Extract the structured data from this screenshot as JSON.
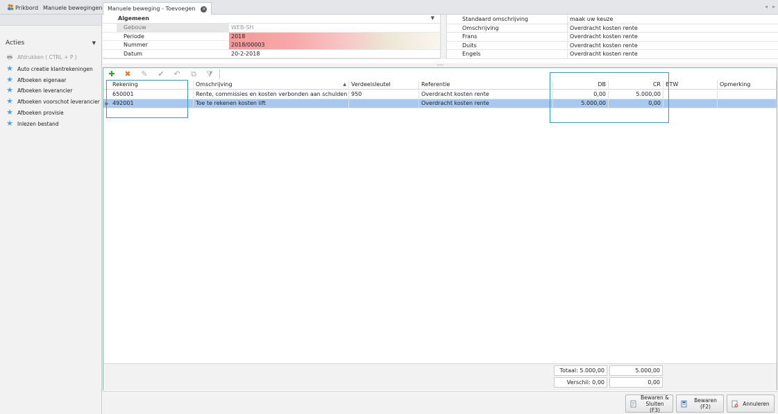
{
  "tabs": [
    {
      "label": "Prikbord",
      "icon": "people-icon"
    },
    {
      "label": "Manuele bewegingen"
    },
    {
      "label": "Manuele beweging - Toevoegen",
      "active": true
    }
  ],
  "sidebar": {
    "title": "Acties",
    "items": [
      {
        "label": "Afdrukken ( CTRL + P )",
        "disabled": true,
        "icon": "printer-icon"
      },
      {
        "label": "Auto creatie klantrekeningen",
        "icon": "star-icon"
      },
      {
        "label": "Afboeken eigenaar",
        "icon": "star-icon"
      },
      {
        "label": "Afboeken leverancier",
        "icon": "star-icon"
      },
      {
        "label": "Afboeken voorschot leverancier",
        "icon": "star-icon"
      },
      {
        "label": "Afboeken provisie",
        "icon": "star-icon"
      },
      {
        "label": "Inlezen bestand",
        "icon": "star-icon"
      }
    ]
  },
  "form_left": {
    "group_title": "Algemeen",
    "rows": [
      {
        "label": "Gebouw",
        "value": "WEB-SH"
      },
      {
        "label": "Periode",
        "value": "2018"
      },
      {
        "label": "Nummer",
        "value": "2018/00003"
      },
      {
        "label": "Datum",
        "value": "20-2-2018"
      }
    ]
  },
  "form_right": {
    "rows": [
      {
        "label": "Standaard omschrijving",
        "value": "maak uw keuze"
      },
      {
        "label": "Omschrijving",
        "value": "Overdracht kosten rente"
      },
      {
        "label": "Frans",
        "value": "Overdracht kosten rente"
      },
      {
        "label": "Duits",
        "value": "Overdracht kosten rente"
      },
      {
        "label": "Engels",
        "value": "Overdracht kosten rente"
      }
    ]
  },
  "grid": {
    "columns": [
      "Rekening",
      "Omschrijving",
      "Verdeelsleutel",
      "Referentie",
      "DB",
      "CR",
      "BTW",
      "Opmerking"
    ],
    "rows": [
      {
        "rekening": "650001",
        "omschrijving": "Rente, commissies en kosten verbonden aan schulden",
        "verdeelsleutel": "950",
        "referentie": "Overdracht kosten rente",
        "db": "0,00",
        "cr": "5.000,00",
        "btw": "",
        "opmerking": ""
      },
      {
        "rekening": "492001",
        "omschrijving": "Toe te rekenen kosten lift",
        "verdeelsleutel": "",
        "referentie": "Overdracht kosten rente",
        "db": "5.000,00",
        "cr": "0,00",
        "btw": "",
        "opmerking": "",
        "selected": true
      }
    ]
  },
  "totals": {
    "totaal_db": "Totaal: 5.000,00",
    "totaal_cr": "5.000,00",
    "verschil_db": "Verschil: 0,00",
    "verschil_cr": "0,00"
  },
  "buttons": {
    "save_close": "Bewaren & Sluiten (F3)",
    "save": "Bewaren (F2)",
    "cancel": "Annuleren"
  },
  "colors": {
    "accent": "#3a96c4",
    "selected_row": "#a9c8f0",
    "panel_border": "#7fb7a3",
    "star": "#4ea1d8"
  }
}
